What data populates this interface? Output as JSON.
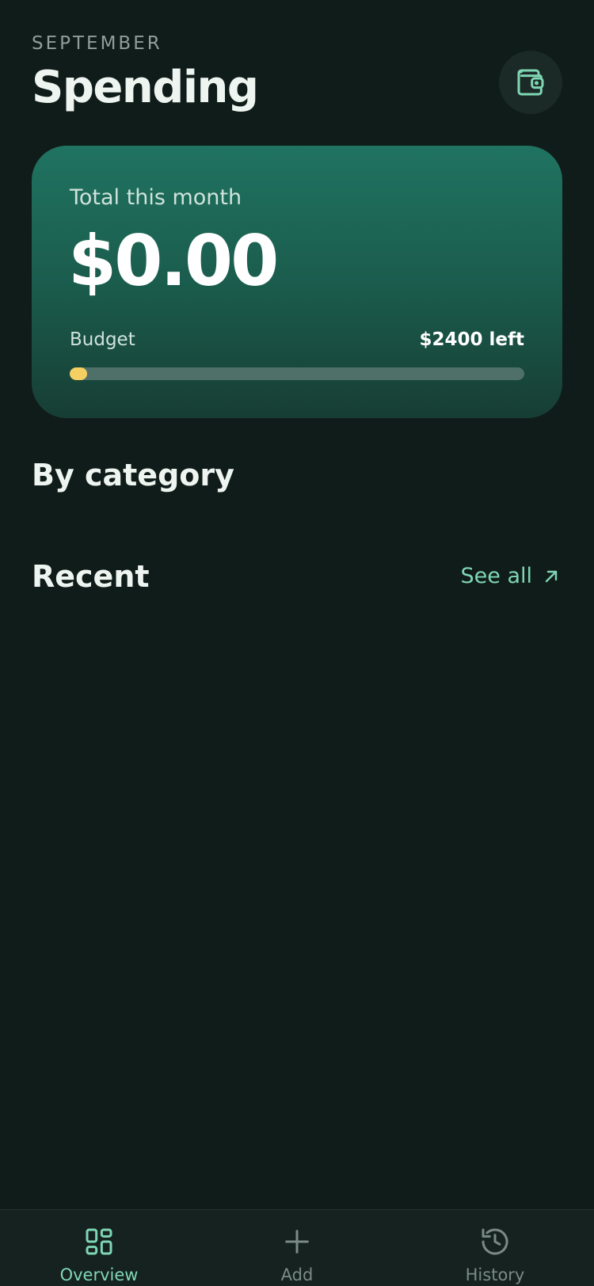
{
  "header": {
    "month": "SEPTEMBER",
    "title": "Spending",
    "wallet_icon": "wallet-icon"
  },
  "summary_card": {
    "label": "Total this month",
    "amount": "$0.00",
    "budget_label": "Budget",
    "budget_left": "$2400 left",
    "budget_used_fraction": 0.0,
    "colors": {
      "progress_fill": "#f5cf62",
      "card_top": "#207361"
    }
  },
  "sections": {
    "by_category": "By category",
    "recent": "Recent",
    "see_all": "See all",
    "see_all_icon": "arrow-up-right-icon"
  },
  "tabbar": {
    "tabs": [
      {
        "label": "Overview",
        "icon": "grid-icon",
        "active": true
      },
      {
        "label": "Add",
        "icon": "plus-icon",
        "active": false
      },
      {
        "label": "History",
        "icon": "history-icon",
        "active": false
      }
    ]
  },
  "colors": {
    "accent": "#7fd6b5",
    "background": "#101c19"
  }
}
